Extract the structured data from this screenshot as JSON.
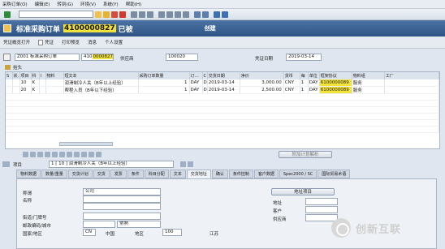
{
  "menu": [
    "采购订单(O)",
    "编辑(E)",
    "转到(G)",
    "环境(V)",
    "系统(Y)",
    "帮助(H)"
  ],
  "title": {
    "text": "标准采购订单",
    "number_highlight": "4100000827",
    "suffix": "已被",
    "suffix2": "创建"
  },
  "appbar": [
    "凭证概览打开",
    "凭证",
    "打印预览",
    "消息",
    "个人设置"
  ],
  "header": {
    "doc_type": "Z001 标准采购订单",
    "po_number_prefix": "410",
    "po_number_highlight": "0000827",
    "vendor_label": "供应商",
    "vendor_value": "100020",
    "doc_date_label": "凭证日期",
    "doc_date_value": "2019-03-14",
    "section_label": "抬头"
  },
  "grid": {
    "columns": [
      "S",
      "状.",
      "项目",
      "科",
      "I",
      "物料",
      "短文本",
      "采购订单数量",
      "订...",
      "C",
      "交货日期",
      "净价",
      "货币",
      "每",
      "单位",
      "框架协议",
      "物料组",
      "工厂"
    ],
    "rows": [
      {
        "item": "10",
        "acct": "K",
        "text": "润滑制冷人关（B年以上经验）",
        "qty": "1",
        "unit": "DAY",
        "c": "D",
        "date": "2019-03-14",
        "price": "3,000.00",
        "curr": "CNY",
        "per": "1",
        "ou": "DAY",
        "agreement_pre": "61",
        "agreement_hl": "00000089",
        "matgrp": "服务"
      },
      {
        "item": "20",
        "acct": "K",
        "text": "帮程入员（B年以下经验）",
        "qty": "1",
        "unit": "DAY",
        "c": "D",
        "date": "2019-03-14",
        "price": "2,500.00",
        "curr": "CNY",
        "per": "1",
        "ou": "DAY",
        "agreement_pre": "61",
        "agreement_hl": "00000089",
        "matgrp": "服务"
      }
    ]
  },
  "bottom_button": "附加计划解析",
  "item_selector": {
    "label": "项目",
    "value": "1 [ 10 ] 润滑制冷人关（B年以上经验）"
  },
  "tabs": [
    "物料数据",
    "数量/重量",
    "交货计划",
    "交货",
    "发票",
    "条件",
    "科目分配",
    "文本",
    "交货地址",
    "确认",
    "条件控制",
    "客户数据",
    "Spec2000 / SC",
    "国际贸易术语"
  ],
  "address": {
    "title_label": "称谓",
    "title_value": "公司",
    "address_btn": "地址项目",
    "name_label": "名称",
    "street_label": "街道/门牌号",
    "postcode_label": "邮政编码/城市",
    "city_value": "常熟",
    "country_label": "国家/地区",
    "country_code": "CN",
    "country_name": "中国",
    "region_label": "地区",
    "region_code": "100",
    "region_name": "江苏",
    "addr_label": "地址",
    "customer_label": "客户",
    "vendor_label": "供应商"
  },
  "logo_text": "创新互联"
}
